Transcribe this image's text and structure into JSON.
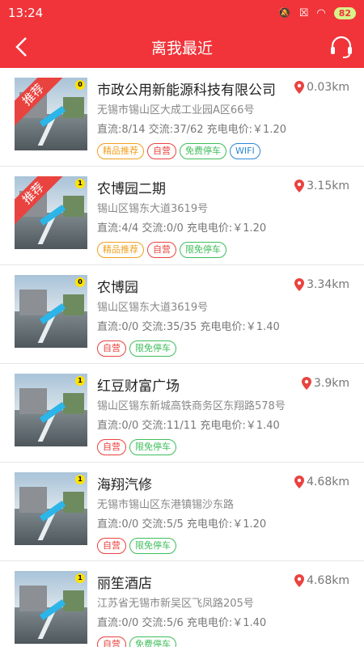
{
  "status": {
    "time": "13:24",
    "battery": "82",
    "icons": [
      "mute-icon",
      "silent-icon",
      "sim-icon",
      "wifi-icon"
    ]
  },
  "header": {
    "title": "离我最近",
    "back_icon": "back-arrow-icon",
    "service_icon": "headset-icon"
  },
  "colors": {
    "primary": "#f0343a",
    "recommend": "#f0a01e",
    "self": "#e9433f",
    "free": "#3ebd5a",
    "wifi": "#2d86d6"
  },
  "stations": [
    {
      "name": "市政公用新能源科技有限公司",
      "address": "无锡市锡山区大成工业园A区66号",
      "stats": "直流:8/14 交流:37/62  充电电价:￥1.20",
      "distance": "0.03km",
      "recommended": true,
      "ribbon": "推荐",
      "thumb_num": "0",
      "tags": [
        {
          "label": "精品推荐",
          "type": "jp"
        },
        {
          "label": "自营",
          "type": "zy"
        },
        {
          "label": "免费停车",
          "type": "free"
        },
        {
          "label": "WIFI",
          "type": "wifi"
        }
      ]
    },
    {
      "name": "农博园二期",
      "address": "锡山区锡东大道3619号",
      "stats": "直流:4/4 交流:0/0  充电电价:￥1.20",
      "distance": "3.15km",
      "recommended": true,
      "ribbon": "推荐",
      "thumb_num": "1",
      "tags": [
        {
          "label": "精品推荐",
          "type": "jp"
        },
        {
          "label": "自营",
          "type": "zy"
        },
        {
          "label": "限免停车",
          "type": "free"
        }
      ]
    },
    {
      "name": "农博园",
      "address": "锡山区锡东大道3619号",
      "stats": "直流:0/0 交流:35/35  充电电价:￥1.40",
      "distance": "3.34km",
      "recommended": false,
      "ribbon": "",
      "thumb_num": "0",
      "tags": [
        {
          "label": "自营",
          "type": "zy"
        },
        {
          "label": "限免停车",
          "type": "free"
        }
      ]
    },
    {
      "name": "红豆财富广场",
      "address": "锡山区锡东新城高铁商务区东翔路578号",
      "stats": "直流:0/0 交流:11/11  充电电价:￥1.40",
      "distance": "3.9km",
      "recommended": false,
      "ribbon": "",
      "thumb_num": "1",
      "tags": [
        {
          "label": "自营",
          "type": "zy"
        },
        {
          "label": "限免停车",
          "type": "free"
        }
      ]
    },
    {
      "name": "海翔汽修",
      "address": "无锡市锡山区东港镇锡沙东路",
      "stats": "直流:0/0 交流:5/5  充电电价:￥1.20",
      "distance": "4.68km",
      "recommended": false,
      "ribbon": "",
      "thumb_num": "1",
      "tags": [
        {
          "label": "自营",
          "type": "zy"
        },
        {
          "label": "限免停车",
          "type": "free"
        }
      ]
    },
    {
      "name": "丽笙酒店",
      "address": "江苏省无锡市新吴区飞凤路205号",
      "stats": "直流:0/0 交流:5/6  充电电价:￥1.40",
      "distance": "4.68km",
      "recommended": false,
      "ribbon": "",
      "thumb_num": "1",
      "tags": [
        {
          "label": "自营",
          "type": "zy"
        },
        {
          "label": "免费停车",
          "type": "free"
        }
      ]
    }
  ]
}
